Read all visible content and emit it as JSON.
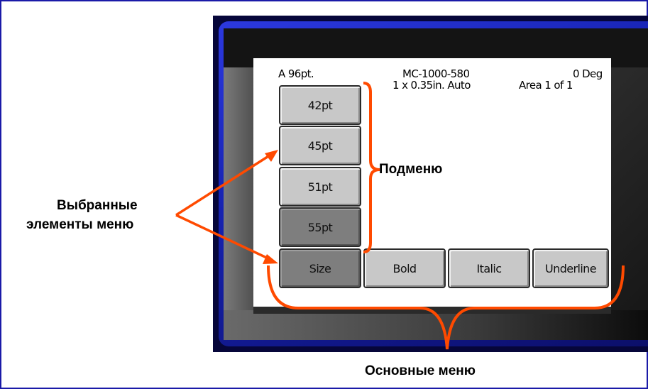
{
  "screen": {
    "status": {
      "font_size": "A 96pt.",
      "label_type": "MC-1000-580",
      "label_dims": "1 x 0.35in.  Auto",
      "rotation": "0 Deg",
      "area": "Area  1 of 1"
    },
    "submenu": [
      "42pt",
      "45pt",
      "51pt",
      "55pt"
    ],
    "main_menu": [
      "Size",
      "Bold",
      "Italic",
      "Underline"
    ]
  },
  "callouts": {
    "submenu": "Подменю",
    "selected_line1": "Выбранные",
    "selected_line2": "элементы меню",
    "main_menus": "Основные меню"
  },
  "colors": {
    "frame_blue": "#1a1aa8",
    "bracket_orange": "#ff4a00",
    "selected_button": "#7e7e7e",
    "button": "#c8c8c8"
  }
}
